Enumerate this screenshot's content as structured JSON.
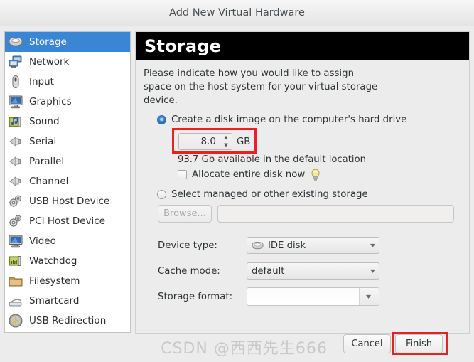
{
  "window": {
    "title": "Add New Virtual Hardware"
  },
  "sidebar": {
    "items": [
      {
        "label": "Storage",
        "icon": "hard-disk-icon",
        "selected": true
      },
      {
        "label": "Network",
        "icon": "network-icon",
        "selected": false
      },
      {
        "label": "Input",
        "icon": "mouse-icon",
        "selected": false
      },
      {
        "label": "Graphics",
        "icon": "monitor-icon",
        "selected": false
      },
      {
        "label": "Sound",
        "icon": "sound-card-icon",
        "selected": false
      },
      {
        "label": "Serial",
        "icon": "serial-port-icon",
        "selected": false
      },
      {
        "label": "Parallel",
        "icon": "parallel-port-icon",
        "selected": false
      },
      {
        "label": "Channel",
        "icon": "channel-port-icon",
        "selected": false
      },
      {
        "label": "USB Host Device",
        "icon": "gears-icon",
        "selected": false
      },
      {
        "label": "PCI Host Device",
        "icon": "gears-icon",
        "selected": false
      },
      {
        "label": "Video",
        "icon": "video-monitor-icon",
        "selected": false
      },
      {
        "label": "Watchdog",
        "icon": "pci-card-icon",
        "selected": false
      },
      {
        "label": "Filesystem",
        "icon": "folder-icon",
        "selected": false
      },
      {
        "label": "Smartcard",
        "icon": "smartcard-reader-icon",
        "selected": false
      },
      {
        "label": "USB Redirection",
        "icon": "usb-icon",
        "selected": false
      }
    ]
  },
  "main": {
    "header": "Storage",
    "description": "Please indicate how you would like to assign\nspace on the host system for your virtual storage\ndevice.",
    "option_create": {
      "label": "Create a disk image on the computer's hard drive",
      "selected": true,
      "size_value": "8.0",
      "size_unit": "GB",
      "available_text": "93.7 Gb available in the default location",
      "allocate_label": "Allocate entire disk now",
      "allocate_checked": false,
      "tip_icon": "lightbulb-icon"
    },
    "option_existing": {
      "label": "Select managed or other existing storage",
      "selected": false,
      "browse_label": "Browse...",
      "browse_disabled": true,
      "path_value": ""
    },
    "fields": [
      {
        "label": "Device type:",
        "value": "IDE disk",
        "icon": "hard-disk-icon",
        "type": "combo"
      },
      {
        "label": "Cache mode:",
        "value": "default",
        "icon": "",
        "type": "combo"
      },
      {
        "label": "Storage format:",
        "value": "",
        "icon": "",
        "type": "combo-entry"
      }
    ]
  },
  "footer": {
    "cancel_label": "Cancel",
    "finish_label": "Finish"
  },
  "watermark": {
    "text": "CSDN @西西先生666"
  },
  "colors": {
    "selection_blue": "#3a86d4",
    "highlight_red": "#ec2024",
    "header_black": "#000000",
    "panel_grey": "#ececec"
  }
}
